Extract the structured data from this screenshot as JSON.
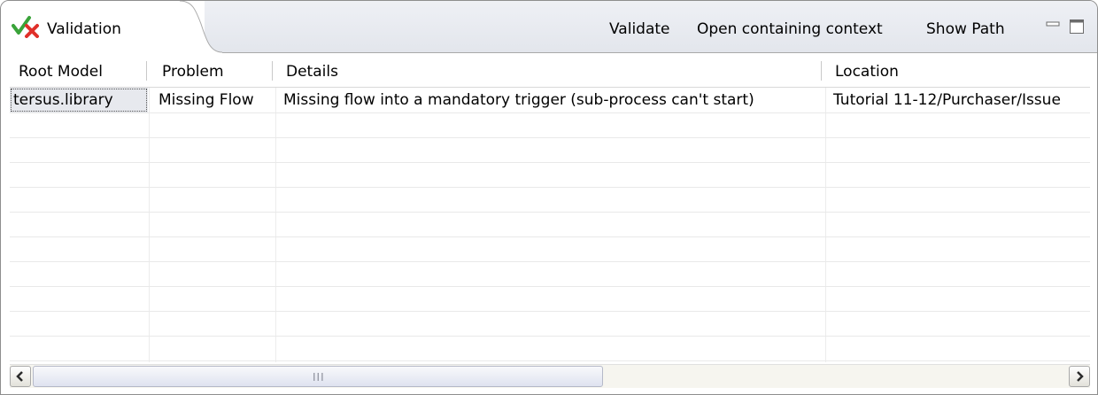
{
  "view": {
    "title": "Validation",
    "icon": "validation-check-cross-icon",
    "actions": {
      "validate": "Validate",
      "open_context": "Open containing context",
      "show_path": "Show Path"
    }
  },
  "table": {
    "columns": [
      "Root Model",
      "Problem",
      "Details",
      "Location"
    ],
    "rows": [
      {
        "root_model": "tersus.library",
        "problem": "Missing Flow",
        "details": "Missing flow into a mandatory trigger (sub-process can't start)",
        "location": "Tutorial 11-12/Purchaser/Issue"
      }
    ]
  },
  "scrollbar": {
    "left_arrow": "left-arrow-icon",
    "right_arrow": "right-arrow-icon",
    "grip": "III"
  },
  "colors": {
    "check": "#3aa33a",
    "cross": "#e0302a",
    "title_bg": "#e6e9ef",
    "border": "#8e8e8e"
  }
}
